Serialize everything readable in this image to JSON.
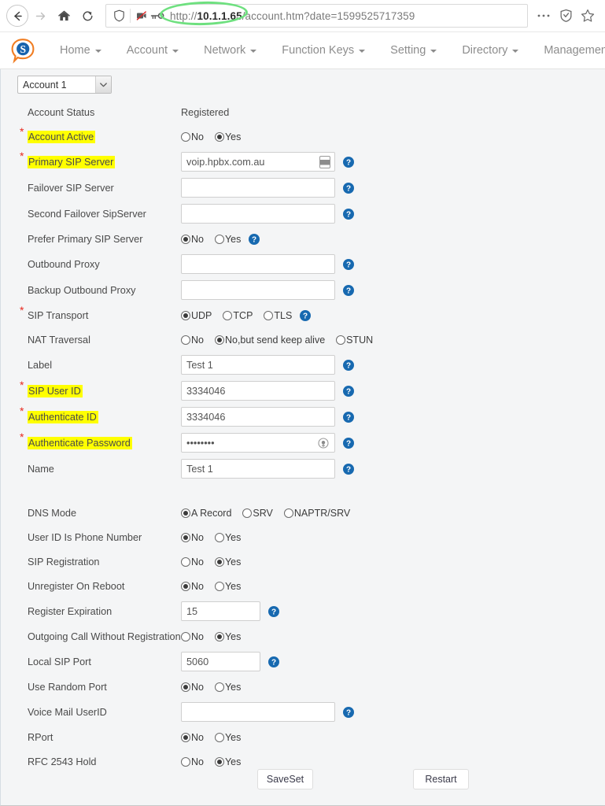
{
  "browser": {
    "back_label": "Back",
    "forward_label": "Forward",
    "home_label": "Home",
    "reload_label": "Reload",
    "url_scheme": "http://",
    "url_host": "10.1.1.65",
    "url_path": "/account.htm?date=1599525717359",
    "url_full": "http://10.1.1.65/account.htm?date=1599525717359",
    "menu_label": "Open menu",
    "tracking_label": "Tracking protection",
    "bookmark_label": "Bookmark this page",
    "annotation_color": "#6ee07f"
  },
  "app": {
    "brand_name": "logo",
    "nav": [
      {
        "label": "Home"
      },
      {
        "label": "Account"
      },
      {
        "label": "Network"
      },
      {
        "label": "Function Keys"
      },
      {
        "label": "Setting"
      },
      {
        "label": "Directory"
      },
      {
        "label": "Management"
      }
    ]
  },
  "page": {
    "account_selector": {
      "value": "Account 1"
    },
    "highlight_color": "#ffff00",
    "required_color": "#e8281e",
    "rows": [
      {
        "label": "Account Status",
        "required": false,
        "highlight": false,
        "type": "status",
        "value": "Registered"
      },
      {
        "label": "Account Active",
        "required": true,
        "highlight": true,
        "type": "radio",
        "options": [
          "No",
          "Yes"
        ],
        "selected": "Yes",
        "help": false
      },
      {
        "label": "Primary SIP Server",
        "required": true,
        "highlight": true,
        "type": "text",
        "value": "voip.hpbx.com.au",
        "width": "wide",
        "autofill": true,
        "help": true
      },
      {
        "label": "Failover SIP Server",
        "required": false,
        "highlight": false,
        "type": "text",
        "value": "",
        "width": "wide",
        "help": true
      },
      {
        "label": "Second Failover SipServer",
        "required": false,
        "highlight": false,
        "type": "text",
        "value": "",
        "width": "wide",
        "help": true
      },
      {
        "label": "Prefer Primary SIP Server",
        "required": false,
        "highlight": false,
        "type": "radio",
        "options": [
          "No",
          "Yes"
        ],
        "selected": "No",
        "help": true
      },
      {
        "label": "Outbound Proxy",
        "required": false,
        "highlight": false,
        "type": "text",
        "value": "",
        "width": "wide",
        "help": true
      },
      {
        "label": "Backup Outbound Proxy",
        "required": false,
        "highlight": false,
        "type": "text",
        "value": "",
        "width": "wide",
        "help": true
      },
      {
        "label": "SIP Transport",
        "required": true,
        "highlight": false,
        "type": "radio",
        "options": [
          "UDP",
          "TCP",
          "TLS"
        ],
        "selected": "UDP",
        "help": true
      },
      {
        "label": "NAT Traversal",
        "required": false,
        "highlight": false,
        "type": "radio",
        "options": [
          "No",
          "No,but send keep alive",
          "STUN"
        ],
        "selected": "No,but send keep alive",
        "help": false
      },
      {
        "label": "Label",
        "required": false,
        "highlight": false,
        "type": "text",
        "value": "Test 1",
        "width": "wide",
        "help": true
      },
      {
        "label": "SIP User ID",
        "required": true,
        "highlight": true,
        "type": "text",
        "value": "3334046",
        "width": "wide",
        "help": true
      },
      {
        "label": "Authenticate ID",
        "required": true,
        "highlight": true,
        "type": "text",
        "value": "3334046",
        "width": "wide",
        "help": true
      },
      {
        "label": "Authenticate Password",
        "required": true,
        "highlight": true,
        "type": "password",
        "value": "••••••••",
        "width": "wide",
        "reveal": true,
        "help": true
      },
      {
        "label": "Name",
        "required": false,
        "highlight": false,
        "type": "text",
        "value": "Test 1",
        "width": "wide",
        "help": true
      },
      {
        "type": "spacer"
      },
      {
        "label": "DNS Mode",
        "required": false,
        "highlight": false,
        "type": "radio",
        "options": [
          "A Record",
          "SRV",
          "NAPTR/SRV"
        ],
        "selected": "A Record",
        "help": false
      },
      {
        "label": "User ID Is Phone Number",
        "required": false,
        "highlight": false,
        "type": "radio",
        "options": [
          "No",
          "Yes"
        ],
        "selected": "No",
        "help": false
      },
      {
        "label": "SIP Registration",
        "required": false,
        "highlight": false,
        "type": "radio",
        "options": [
          "No",
          "Yes"
        ],
        "selected": "Yes",
        "help": false
      },
      {
        "label": "Unregister On Reboot",
        "required": false,
        "highlight": false,
        "type": "radio",
        "options": [
          "No",
          "Yes"
        ],
        "selected": "No",
        "help": false
      },
      {
        "label": "Register Expiration",
        "required": false,
        "highlight": false,
        "type": "text",
        "value": "15",
        "width": "narrow",
        "help": true
      },
      {
        "label": "Outgoing Call Without Registration",
        "required": false,
        "highlight": false,
        "type": "radio",
        "options": [
          "No",
          "Yes"
        ],
        "selected": "Yes",
        "help": false
      },
      {
        "label": "Local SIP Port",
        "required": false,
        "highlight": false,
        "type": "text",
        "value": "5060",
        "width": "narrow",
        "help": true
      },
      {
        "label": "Use Random Port",
        "required": false,
        "highlight": false,
        "type": "radio",
        "options": [
          "No",
          "Yes"
        ],
        "selected": "No",
        "help": false
      },
      {
        "label": "Voice Mail UserID",
        "required": false,
        "highlight": false,
        "type": "text",
        "value": "",
        "width": "wide",
        "help": true
      },
      {
        "label": "RPort",
        "required": false,
        "highlight": false,
        "type": "radio",
        "options": [
          "No",
          "Yes"
        ],
        "selected": "No",
        "help": false
      },
      {
        "label": "RFC 2543 Hold",
        "required": false,
        "highlight": false,
        "type": "radio",
        "options": [
          "No",
          "Yes"
        ],
        "selected": "Yes",
        "help": false
      }
    ],
    "buttons": {
      "save_label": "SaveSet",
      "restart_label": "Restart"
    }
  }
}
